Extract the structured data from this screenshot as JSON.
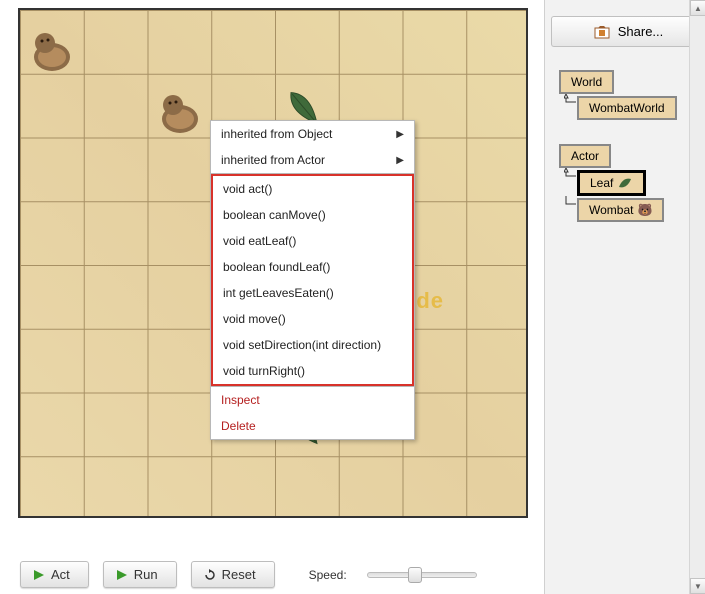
{
  "share_label": "Share...",
  "controls": {
    "act": "Act",
    "run": "Run",
    "reset": "Reset",
    "speed_label": "Speed:"
  },
  "watermark": "www.kidscode",
  "class_tree": {
    "world": "World",
    "wombat_world": "WombatWorld",
    "actor": "Actor",
    "leaf": "Leaf",
    "wombat": "Wombat"
  },
  "context_menu": {
    "parent1": "inherited from Object",
    "parent2": "inherited from Actor",
    "methods": [
      "void act()",
      "boolean canMove()",
      "void eatLeaf()",
      "boolean foundLeaf()",
      "int getLeavesEaten()",
      "void move()",
      "void setDirection(int direction)",
      "void turnRight()"
    ],
    "inspect": "Inspect",
    "delete": "Delete"
  }
}
